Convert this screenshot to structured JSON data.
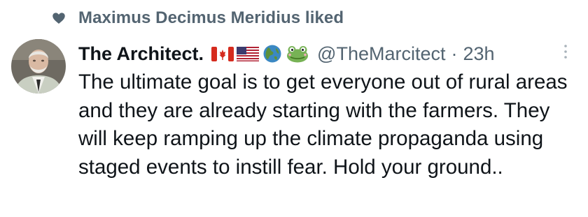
{
  "social_context": {
    "icon": "heart-icon",
    "text": "Maximus Decimus Meridius liked"
  },
  "tweet": {
    "avatar_icon": "avatar-portrait",
    "display_name": "The Architect.",
    "name_emojis": [
      "canada-flag-icon",
      "usa-flag-icon",
      "globe-icon",
      "frog-icon"
    ],
    "handle": "@TheMarcitect",
    "separator": "·",
    "timestamp": "23h",
    "more_icon": "more-options-icon",
    "text": "The ultimate goal is to get everyone out of rural areas and they are already starting with the farmers. They will keep ramping up the climate propaganda using staged events to instill fear. Hold your ground.."
  },
  "colors": {
    "primary_text": "#0f1419",
    "secondary_text": "#536471",
    "background": "#ffffff"
  }
}
